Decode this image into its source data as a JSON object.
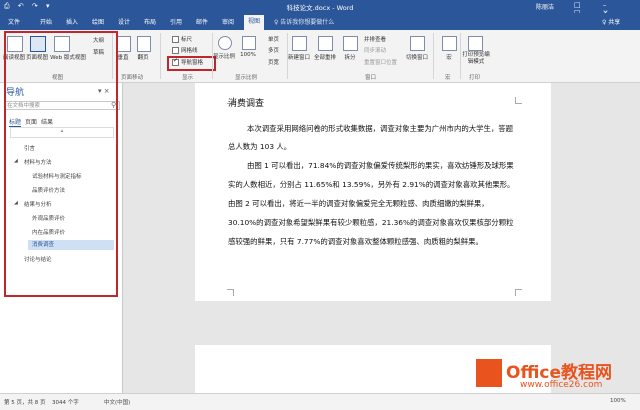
{
  "titlebar": {
    "qat": "⎙ ↶ ↷ ▾",
    "document_title": "科技论文.docx - Word",
    "user": "陈丽洁",
    "window_buttons": "□ – ☐ ✕"
  },
  "tabs": [
    "文件",
    "开始",
    "插入",
    "绘图",
    "设计",
    "布局",
    "引用",
    "邮件",
    "审阅",
    "视图"
  ],
  "active_tab": "视图",
  "tell_me": "♀ 告诉我你想要做什么",
  "share": "♀ 共享",
  "ribbon": {
    "views": {
      "read_mode": "阅读视图",
      "print_layout": "页面视图",
      "web_layout": "Web 版式视图",
      "outline": "大纲",
      "draft": "草稿",
      "group": "视图"
    },
    "page_movement": {
      "vertical": "垂直",
      "side_to_side": "翻页",
      "group": "页面移动"
    },
    "show": {
      "ruler": "标尺",
      "gridlines": "网格线",
      "navigation_pane": "导航窗格",
      "group": "显示"
    },
    "zoom": {
      "zoom": "显示比例",
      "pct100": "100%",
      "one_page": "单页",
      "multi_page": "多页",
      "page_width": "页宽",
      "group": "显示比例"
    },
    "window": {
      "new_window": "新建窗口",
      "arrange_all": "全部重排",
      "split": "拆分",
      "side_by_side": "并排查看",
      "sync_scroll": "同步滚动",
      "reset_pos": "重置窗口位置",
      "switch": "切换窗口",
      "group": "窗口"
    },
    "macros": {
      "label": "宏",
      "group": "宏"
    },
    "print": {
      "label": "打印预览编辑模式",
      "group": "打印"
    }
  },
  "nav": {
    "title": "导航",
    "close": "▾ ×",
    "search_placeholder": "在文档中搜索",
    "tabs": [
      "标题",
      "页面",
      "结果"
    ],
    "items": [
      {
        "label": "引言",
        "level": 1
      },
      {
        "label": "材料与方法",
        "level": 1,
        "expanded": true
      },
      {
        "label": "试验材料与测定指标",
        "level": 2
      },
      {
        "label": "品质评价方法",
        "level": 2
      },
      {
        "label": "结果与分析",
        "level": 1,
        "expanded": true
      },
      {
        "label": "外观品质评价",
        "level": 2
      },
      {
        "label": "内在品质评价",
        "level": 2
      },
      {
        "label": "消费调查",
        "level": 2,
        "selected": true
      },
      {
        "label": "讨论与结论",
        "level": 1
      }
    ]
  },
  "document": {
    "heading": "消费调查",
    "lines": [
      "本次调查采用网络问卷的形式收集数据，调查对象主要为广州市内的大学生，答题",
      "总人数为 103 人。",
      "由图 1 可以看出，71.84%的调查对象偏爱传统梨形的果实，喜欢纺锤形及球形果",
      "实的人数相近，分别占 11.65%和 13.59%，另外有 2.91%的调查对象喜欢其他果形。",
      "由图 2 可以看出，将近一半的调查对象偏爱完全无颗粒感、肉质细嫩的梨鲜果，",
      "30.10%的调查对象希望梨鲜果有较少颗粒感，21.36%的调查对象喜欢仅果核部分颗粒",
      "感较强的鲜果，只有 7.77%的调查对象喜欢整体颗粒感强、肉质粗的梨鲜果。"
    ]
  },
  "status": {
    "page": "第 5 页，共 8 页",
    "words": "3044 个字",
    "lang": "中文(中国)",
    "zoom": "100%"
  },
  "watermark": {
    "brand": "Office教程网",
    "url": "www.office26.com"
  }
}
